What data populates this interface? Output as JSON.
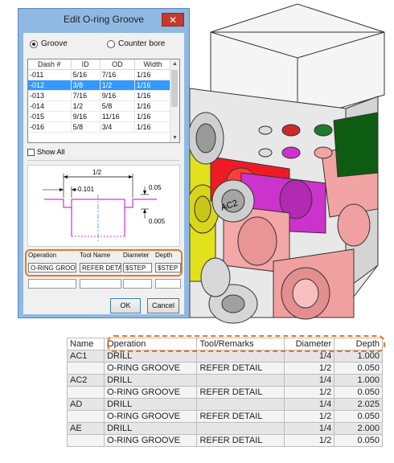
{
  "dialog": {
    "title": "Edit O-ring Groove",
    "close_label": "✕",
    "radio_groove": "Groove",
    "radio_counterbore": "Counter bore",
    "grid": {
      "headers": [
        "Dash #",
        "ID",
        "OD",
        "Width"
      ],
      "rows": [
        [
          "-011",
          "5/16",
          "7/16",
          "1/16"
        ],
        [
          "-012",
          "3/8",
          "1/2",
          "1/16"
        ],
        [
          "-013",
          "7/16",
          "9/16",
          "1/16"
        ],
        [
          "-014",
          "1/2",
          "5/8",
          "1/16"
        ],
        [
          "-015",
          "9/16",
          "11/16",
          "1/16"
        ],
        [
          "-016",
          "5/8",
          "3/4",
          "1/16"
        ]
      ],
      "selected_row": "-012"
    },
    "show_all": "Show All",
    "sketch": {
      "dim_width": "1/2",
      "dim_left": "0.101",
      "dim_top": "0.05",
      "dim_bottom": "0.005"
    },
    "params": {
      "operation_label": "Operation",
      "toolname_label": "Tool Name",
      "diameter_label": "Diameter",
      "depth_label": "Depth",
      "operation_value": "O-RING GROOVE",
      "toolname_value": "REFER DETAIL",
      "diameter_value": "$STEP",
      "depth_value": "$STEP"
    },
    "ok_label": "OK",
    "cancel_label": "Cancel"
  },
  "cad_label": "AC2",
  "table": {
    "headers": [
      "Name",
      "Operation",
      "Tool/Remarks",
      "Diameter",
      "Depth"
    ],
    "rows": [
      [
        "AC1",
        "DRILL",
        "",
        "1/4",
        "1.000"
      ],
      [
        "",
        "O-RING GROOVE",
        "REFER DETAIL",
        "1/2",
        "0.050"
      ],
      [
        "AC2",
        "DRILL",
        "",
        "1/4",
        "1.000"
      ],
      [
        "",
        "O-RING GROOVE",
        "REFER DETAIL",
        "1/2",
        "0.050"
      ],
      [
        "AD",
        "DRILL",
        "",
        "1/4",
        "2.025"
      ],
      [
        "",
        "O-RING GROOVE",
        "REFER DETAIL",
        "1/2",
        "0.050"
      ],
      [
        "AE",
        "DRILL",
        "",
        "1/4",
        "2.000"
      ],
      [
        "",
        "O-RING GROOVE",
        "REFER DETAIL",
        "1/2",
        "0.050"
      ]
    ]
  },
  "colors": {
    "highlight": "#e87722",
    "selection": "#3399ff",
    "dialog_frame": "#8fb9e3"
  }
}
